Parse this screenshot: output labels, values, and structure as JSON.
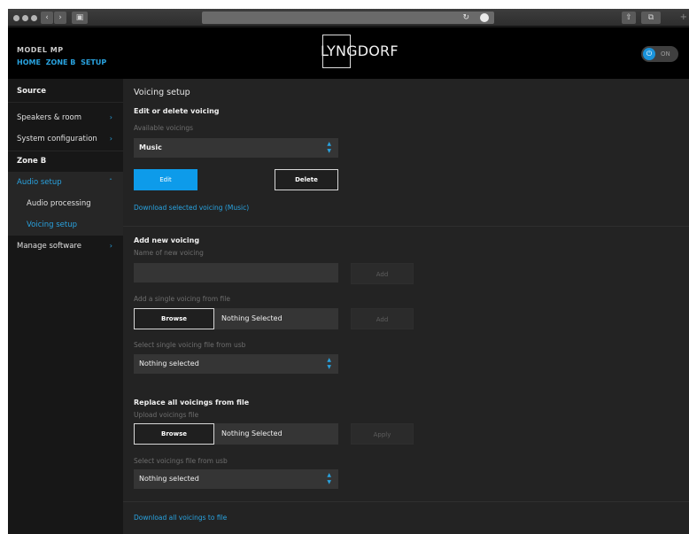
{
  "header": {
    "model": "MODEL MP",
    "breadcrumb": [
      "HOME",
      "ZONE B",
      "SETUP"
    ],
    "logo": "LYNGDORF",
    "power_label": "ON"
  },
  "sidebar": {
    "items": [
      {
        "label": "Source"
      },
      {
        "label": "Speakers & room"
      },
      {
        "label": "System configuration"
      },
      {
        "label": "Zone B"
      },
      {
        "label": "Audio setup"
      },
      {
        "label": "Audio processing"
      },
      {
        "label": "Voicing setup"
      },
      {
        "label": "Manage software"
      }
    ]
  },
  "main": {
    "page_title": "Voicing setup",
    "edit_section": {
      "title": "Edit or delete voicing",
      "available_label": "Available voicings",
      "selected_voicing": "Music",
      "edit_label": "Edit",
      "delete_label": "Delete",
      "download_link": "Download selected voicing (Music)"
    },
    "add_section": {
      "title": "Add new voicing",
      "name_label": "Name of new voicing",
      "name_value": "",
      "add_label": "Add",
      "from_file_label": "Add a single voicing from file",
      "browse_label": "Browse",
      "file_status": "Nothing Selected",
      "add_file_label": "Add",
      "usb_label": "Select single voicing file from usb",
      "usb_value": "Nothing selected"
    },
    "replace_section": {
      "title": "Replace all voicings from file",
      "upload_label": "Upload voicings file",
      "browse_label": "Browse",
      "file_status": "Nothing Selected",
      "apply_label": "Apply",
      "usb_label": "Select voicings file from usb",
      "usb_value": "Nothing selected"
    },
    "download_all_link": "Download all voicings to file"
  },
  "colors": {
    "accent": "#29a3e0",
    "button_blue": "#0d9bea",
    "background": "#232323",
    "sidebar": "#171717"
  }
}
